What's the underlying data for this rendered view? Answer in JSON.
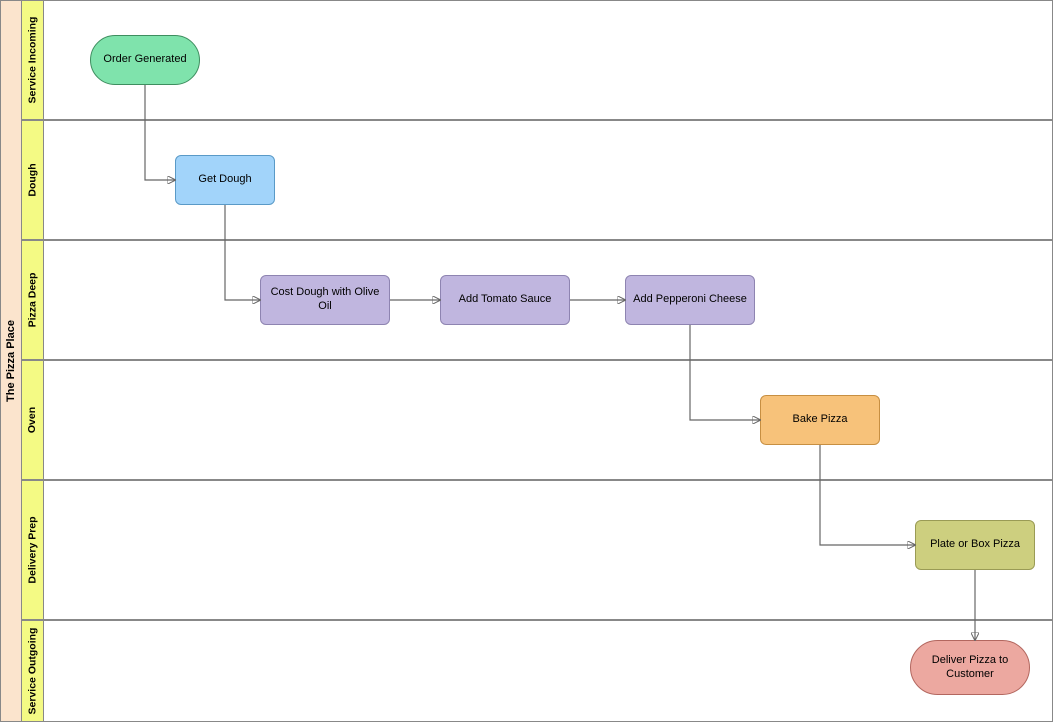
{
  "pool": {
    "title": "The Pizza Place"
  },
  "lanes": [
    {
      "label": "Service Incoming"
    },
    {
      "label": "Dough"
    },
    {
      "label": "Pizza Deep"
    },
    {
      "label": "Oven"
    },
    {
      "label": "Delivery Prep"
    },
    {
      "label": "Service Outgoing"
    }
  ],
  "nodes": {
    "order_generated": "Order Generated",
    "get_dough": "Get Dough",
    "cost_dough": "Cost Dough with Olive Oil",
    "add_sauce": "Add Tomato Sauce",
    "add_top": "Add Pepperoni Cheese",
    "bake": "Bake Pizza",
    "plate": "Plate or Box Pizza",
    "deliver": "Deliver Pizza to Customer"
  },
  "chart_data": {
    "type": "swimlane-flow",
    "pool": "The Pizza Place",
    "lanes": [
      "Service Incoming",
      "Dough",
      "Pizza Deep",
      "Oven",
      "Delivery Prep",
      "Service Outgoing"
    ],
    "nodes": [
      {
        "id": "order_generated",
        "lane": "Service Incoming",
        "type": "start",
        "label": "Order Generated"
      },
      {
        "id": "get_dough",
        "lane": "Dough",
        "type": "task",
        "label": "Get Dough"
      },
      {
        "id": "cost_dough",
        "lane": "Pizza Deep",
        "type": "task",
        "label": "Cost Dough with Olive Oil"
      },
      {
        "id": "add_sauce",
        "lane": "Pizza Deep",
        "type": "task",
        "label": "Add Tomato Sauce"
      },
      {
        "id": "add_top",
        "lane": "Pizza Deep",
        "type": "task",
        "label": "Add Pepperoni Cheese"
      },
      {
        "id": "bake",
        "lane": "Oven",
        "type": "task",
        "label": "Bake Pizza"
      },
      {
        "id": "plate",
        "lane": "Delivery Prep",
        "type": "task",
        "label": "Plate or Box Pizza"
      },
      {
        "id": "deliver",
        "lane": "Service Outgoing",
        "type": "end",
        "label": "Deliver Pizza to Customer"
      }
    ],
    "edges": [
      [
        "order_generated",
        "get_dough"
      ],
      [
        "get_dough",
        "cost_dough"
      ],
      [
        "cost_dough",
        "add_sauce"
      ],
      [
        "add_sauce",
        "add_top"
      ],
      [
        "add_top",
        "bake"
      ],
      [
        "bake",
        "plate"
      ],
      [
        "plate",
        "deliver"
      ]
    ]
  }
}
